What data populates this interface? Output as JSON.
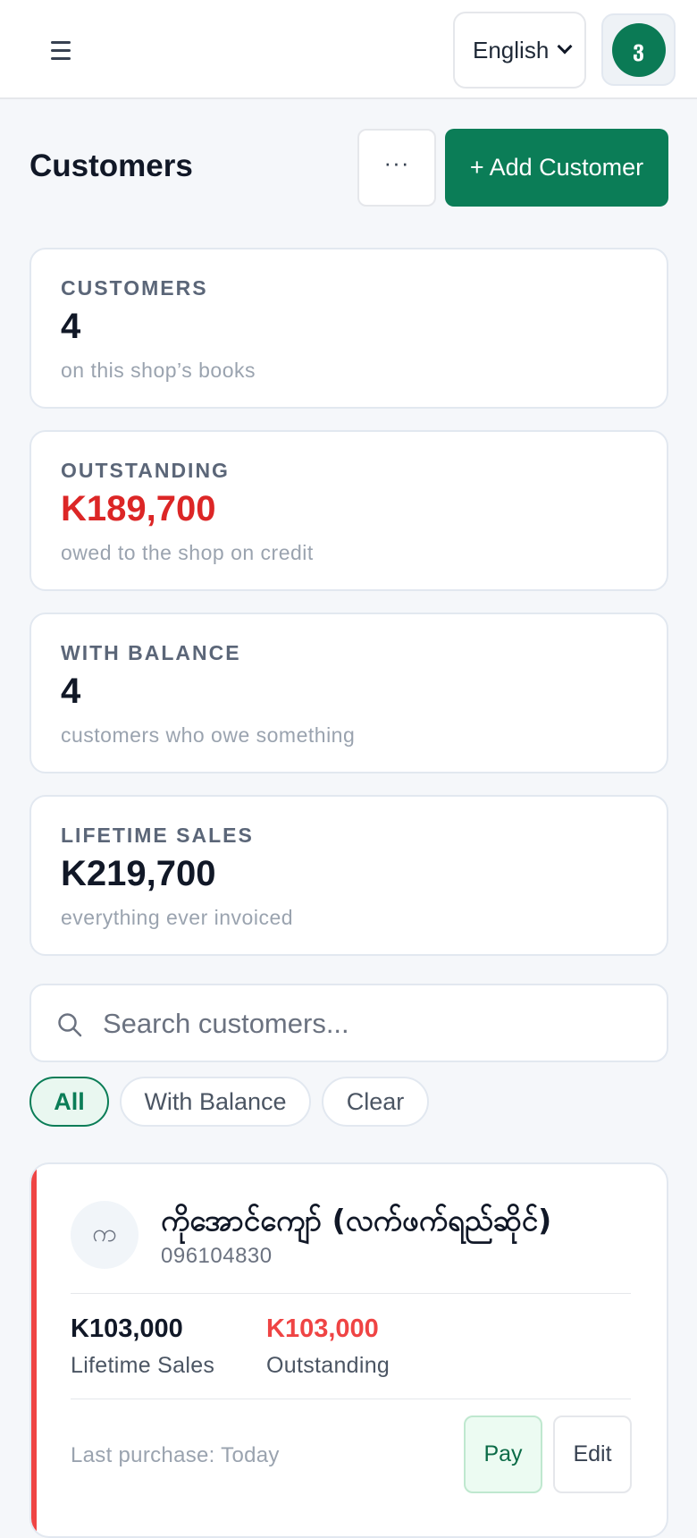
{
  "header": {
    "language": "English",
    "avatar_initial": "ვ"
  },
  "page": {
    "title": "Customers",
    "more_label": "···",
    "add_label": "+ Add Customer"
  },
  "stats": [
    {
      "label": "CUSTOMERS",
      "value": "4",
      "sub": "on this shop’s books"
    },
    {
      "label": "OUTSTANDING",
      "value": "K189,700",
      "sub": "owed to the shop on credit",
      "color": "#dc2626"
    },
    {
      "label": "WITH BALANCE",
      "value": "4",
      "sub": "customers who owe something"
    },
    {
      "label": "LIFETIME SALES",
      "value": "K219,700",
      "sub": "everything ever invoiced"
    }
  ],
  "search": {
    "placeholder": "Search customers..."
  },
  "filters": [
    {
      "label": "All",
      "active": true
    },
    {
      "label": "With Balance",
      "active": false
    },
    {
      "label": "Clear",
      "active": false
    }
  ],
  "customers": [
    {
      "initial": "က",
      "name": "ကိုအောင်ကျော် (လက်ဖက်ရည်ဆိုင်)",
      "phone": "096104830",
      "lifetime_value": "K103,000",
      "lifetime_label": "Lifetime Sales",
      "outstanding_value": "K103,000",
      "outstanding_label": "Outstanding",
      "last_purchase": "Last purchase: Today",
      "pay_label": "Pay",
      "edit_label": "Edit",
      "accent_color": "#ef4444"
    }
  ]
}
